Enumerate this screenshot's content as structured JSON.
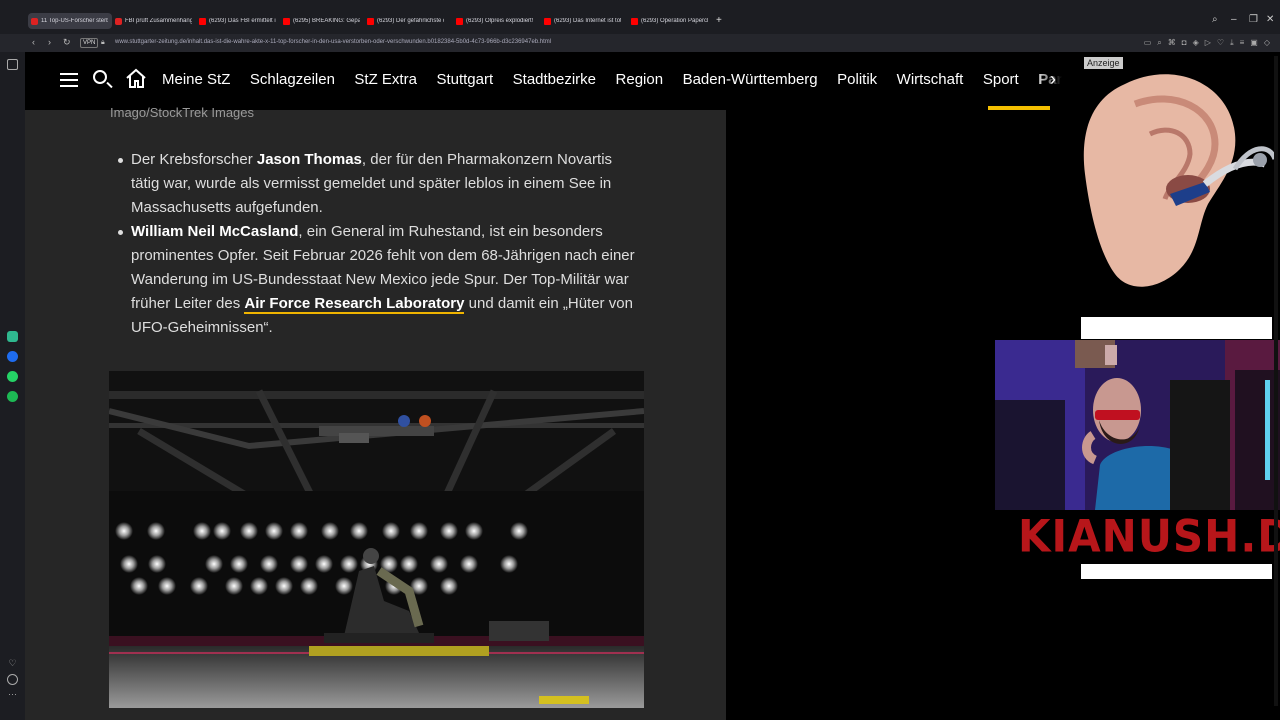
{
  "browser": {
    "tabs": [
      {
        "title": "11 Top-US-Forscher sterb",
        "active": true,
        "icon": "stz-icon"
      },
      {
        "title": "FBI prüft Zusammenhäng",
        "icon": "stz-icon"
      },
      {
        "title": "(6293) Das FBI ermittelt in",
        "icon": "youtube-icon"
      },
      {
        "title": "(6295) BREAKING: Gepan",
        "icon": "youtube-icon"
      },
      {
        "title": "(6293) Der gefährlichste d",
        "icon": "youtube-icon"
      },
      {
        "title": "(6293) Ölpreis explodiert!",
        "icon": "youtube-icon"
      },
      {
        "title": "(6293) Das Internet ist tot",
        "icon": "youtube-icon"
      },
      {
        "title": "(6293) Operation Paperclu",
        "icon": "youtube-icon"
      }
    ],
    "new_tab": "+",
    "vpn_label": "VPN",
    "url": "www.stuttgarter-zeitung.de/inhalt.das-ist-die-wahre-akte-x-11-top-forscher-in-den-usa-verstorben-oder-verschwunden.b0182384-5b0d-4c73-966b-d3c236947eb.html"
  },
  "site": {
    "nav_items": [
      "Meine StZ",
      "Schlagzeilen",
      "StZ Extra",
      "Stuttgart",
      "Stadtbezirke",
      "Region",
      "Baden-Württemberg",
      "Politik",
      "Wirtschaft",
      "Sport",
      "Panoram"
    ],
    "active_nav": "Panoram",
    "nav_more": "›",
    "image_caption": "Imago/StockTrek Images",
    "bullets": {
      "b1_pre": "Der Krebsforscher ",
      "b1_bold": "Jason Thomas",
      "b1_post": ", der für den Pharmakonzern Novartis tätig war, wurde als vermisst gemeldet und später leblos in einem See in Massachusetts aufgefunden.",
      "b2_bold": "William Neil McCasland",
      "b2_mid": ", ein General im Ruhestand, ist ein besonders prominentes Opfer. Seit Februar 2026 fehlt von dem 68-Jährigen nach einer Wanderung im US-Bundesstaat New Mexico jede Spur. Der Top-Militär war früher Leiter des ",
      "b2_link": "Air Force Research Laboratory",
      "b2_post": " und damit ein „Hüter von UFO-Geheimnissen“."
    }
  },
  "ad": {
    "label": "Anzeige"
  },
  "overlay": {
    "brand": "KIANUSH.DE"
  },
  "colors": {
    "accent": "#f5c000",
    "brand_red": "#b7161a",
    "site_bg": "#262626"
  }
}
